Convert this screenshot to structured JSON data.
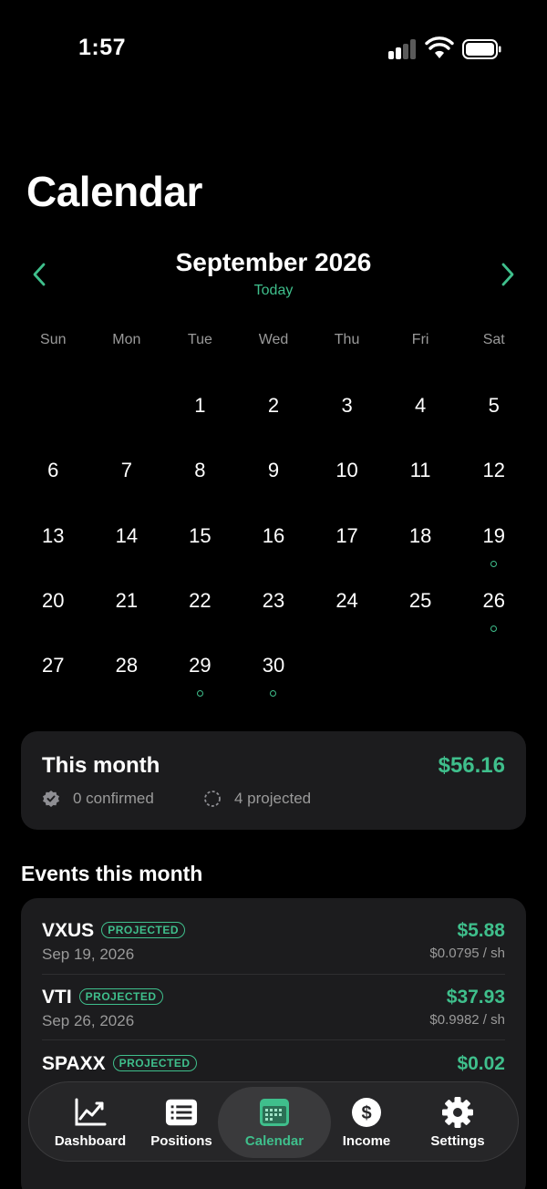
{
  "status": {
    "time": "1:57"
  },
  "page_title": "Calendar",
  "month": {
    "title": "September 2026",
    "today_label": "Today"
  },
  "weekdays": [
    "Sun",
    "Mon",
    "Tue",
    "Wed",
    "Thu",
    "Fri",
    "Sat"
  ],
  "calendar": {
    "leading_blanks": 2,
    "days_in_month": 30,
    "event_days": [
      19,
      26,
      29,
      30
    ]
  },
  "summary": {
    "title": "This month",
    "total": "$56.16",
    "confirmed": "0 confirmed",
    "projected": "4 projected"
  },
  "events_title": "Events this month",
  "events": [
    {
      "symbol": "VXUS",
      "badge": "PROJECTED",
      "date": "Sep 19, 2026",
      "amount": "$5.88",
      "per_share": "$0.0795 / sh"
    },
    {
      "symbol": "VTI",
      "badge": "PROJECTED",
      "date": "Sep 26, 2026",
      "amount": "$37.93",
      "per_share": "$0.9982 / sh"
    },
    {
      "symbol": "SPAXX",
      "badge": "PROJECTED",
      "date": "",
      "amount": "$0.02",
      "per_share": ""
    }
  ],
  "tabs": [
    {
      "label": "Dashboard",
      "icon": "chart-line-icon"
    },
    {
      "label": "Positions",
      "icon": "list-icon"
    },
    {
      "label": "Calendar",
      "icon": "calendar-icon",
      "active": true
    },
    {
      "label": "Income",
      "icon": "dollar-icon"
    },
    {
      "label": "Settings",
      "icon": "gear-icon"
    }
  ],
  "colors": {
    "accent": "#3fbf8c",
    "card": "#1c1c1e",
    "background": "#000000"
  }
}
